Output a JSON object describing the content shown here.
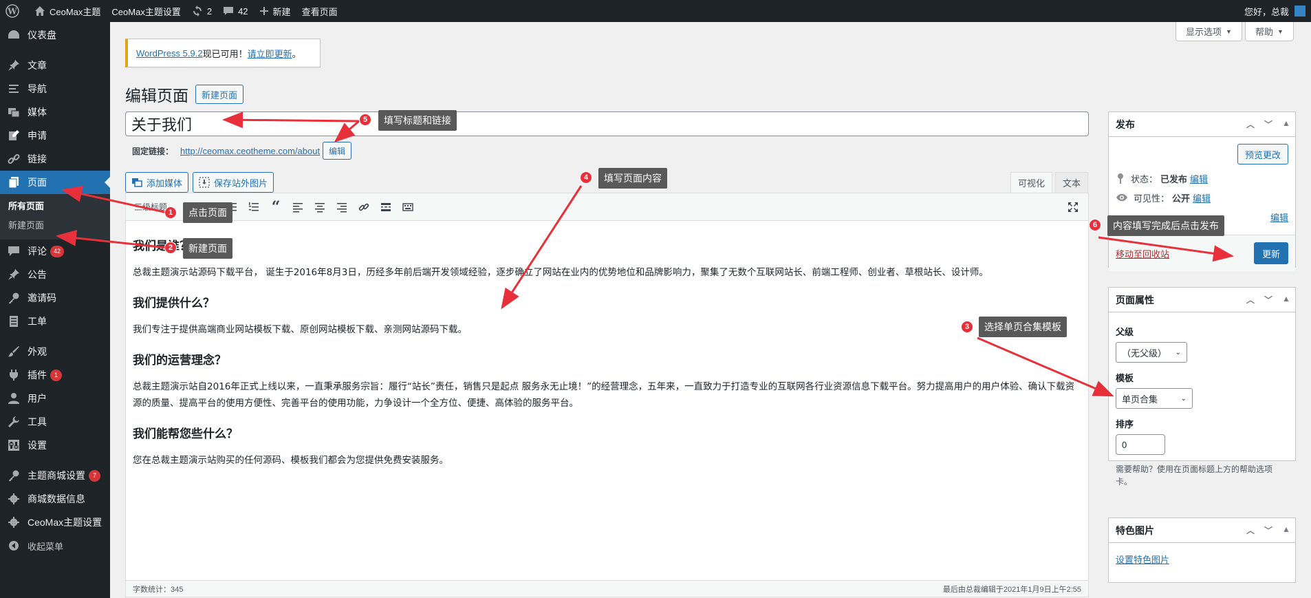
{
  "adminbar": {
    "site_name": "CeoMax主题",
    "theme_settings": "CeoMax主题设置",
    "updates_count": "2",
    "comments_count": "42",
    "new_label": "新建",
    "view_page": "查看页面",
    "greeting": "您好，总裁"
  },
  "sidebar": {
    "dashboard": "仪表盘",
    "posts": "文章",
    "nav": "导航",
    "media": "媒体",
    "apply": "申请",
    "links": "链接",
    "pages": "页面",
    "pages_all": "所有页面",
    "pages_new": "新建页面",
    "comments": "评论",
    "comments_badge": "42",
    "announce": "公告",
    "invite": "邀请码",
    "tickets": "工单",
    "appearance": "外观",
    "plugins": "插件",
    "plugins_badge": "1",
    "users": "用户",
    "tools": "工具",
    "settings": "设置",
    "shop_settings": "主题商城设置",
    "shop_badge": "7",
    "shop_data": "商城数据信息",
    "ceomax_settings": "CeoMax主题设置",
    "collapse": "收起菜单"
  },
  "screen_options": "显示选项",
  "help": "帮助",
  "notice": {
    "link": "WordPress 5.9.2",
    "text": "现已可用！",
    "action": "请立即更新",
    "end": "。"
  },
  "page_title": "编辑页面",
  "new_page_btn": "新建页面",
  "post_title": "关于我们",
  "permalink": {
    "label": "固定链接：",
    "url": "http://ceomax.ceotheme.com/about",
    "edit": "编辑"
  },
  "add_media": "添加媒体",
  "save_external": "保存站外图片",
  "tab_visual": "可视化",
  "tab_text": "文本",
  "format_select": "三级标题",
  "content": {
    "h1": "我们是谁？",
    "p1": "总裁主题演示站源码下载平台， 诞生于2016年8月3日，历经多年前后端开发领域经验，逐步确立了网站在业内的优势地位和品牌影响力，聚集了无数个互联网站长、前端工程师、创业者、草根站长、设计师。",
    "h2": "我们提供什么？",
    "p2": "我们专注于提供高端商业网站模板下载、原创网站模板下载、亲测网站源码下载。",
    "h3": "我们的运营理念？",
    "p3": "总裁主题演示站自2016年正式上线以来，一直秉承服务宗旨：履行“站长”责任，销售只是起点 服务永无止境！”的经营理念，五年来，一直致力于打造专业的互联网各行业资源信息下载平台。努力提高用户的用户体验、确认下载资源的质量、提高平台的使用方便性、完善平台的使用功能，力争设计一个全方位、便捷、高体验的服务平台。",
    "h4": "我们能帮您些什么？",
    "p4": "您在总裁主题演示站购买的任何源码、模板我们都会为您提供免费安装服务。"
  },
  "word_count": "字数统计：345",
  "last_edited": "最后由总裁编辑于2021年1月9日上午2:55",
  "publish": {
    "title": "发布",
    "preview": "预览更改",
    "status_label": "状态：",
    "status_value": "已发布",
    "visibility_label": "可见性：",
    "visibility_value": "公开",
    "edit": "编辑",
    "trash": "移动至回收站",
    "update": "更新"
  },
  "attributes": {
    "title": "页面属性",
    "parent_label": "父级",
    "parent_value": "（无父级）",
    "template_label": "模板",
    "template_value": "单页合集",
    "order_label": "排序",
    "order_value": "0",
    "help": "需要帮助？使用在页面标题上方的帮助选项卡。"
  },
  "featured": {
    "title": "特色图片",
    "set": "设置特色图片"
  },
  "annotations": {
    "a1": "点击页面",
    "a2": "新建页面",
    "a3": "选择单页合集模板",
    "a4": "填写页面内容",
    "a5": "填写标题和链接",
    "a6": "内容填写完成后点击发布",
    "n1": "1",
    "n2": "2",
    "n3": "3",
    "n4": "4",
    "n5": "5",
    "n6": "6"
  },
  "colors": {
    "adminbar": "#1d2327",
    "accent": "#2271b1",
    "annotation_red": "#e8303a",
    "callout_bg": "#595959"
  }
}
